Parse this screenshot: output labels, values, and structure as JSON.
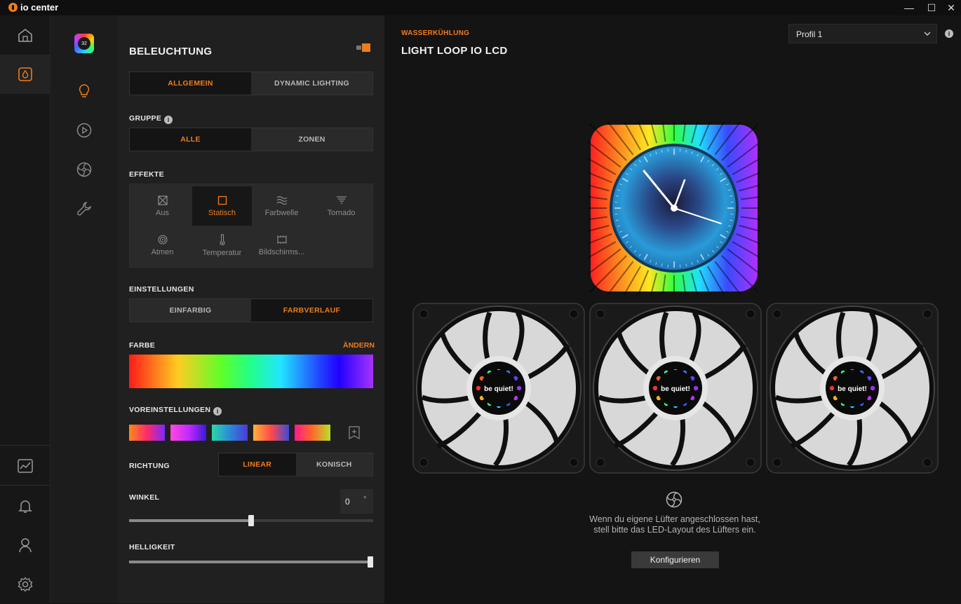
{
  "app": {
    "name": "io center"
  },
  "window_controls": {
    "minimize": "—",
    "maximize": "☐",
    "close": "✕"
  },
  "panel": {
    "title": "BELEUCHTUNG",
    "tabs": [
      "ALLGEMEIN",
      "DYNAMIC LIGHTING"
    ],
    "group_label": "GRUPPE",
    "group_options": [
      "ALLE",
      "ZONEN"
    ],
    "effects_label": "EFFEKTE",
    "effects": [
      "Aus",
      "Statisch",
      "Farbwelle",
      "Tornado",
      "Atmen",
      "Temperatur",
      "Bildschirms..."
    ],
    "selected_effect": "Statisch",
    "settings_label": "EINSTELLUNGEN",
    "settings_options": [
      "EINFARBIG",
      "FARBVERLAUF"
    ],
    "color_label": "FARBE",
    "color_change": "ÄNDERN",
    "presets_label": "VOREINSTELLUNGEN",
    "direction_label": "RICHTUNG",
    "direction_options": [
      "LINEAR",
      "KONISCH"
    ],
    "angle_label": "WINKEL",
    "angle_value": "0",
    "angle_unit": "°",
    "angle_level": 0.5,
    "brightness_label": "HELLIGKEIT",
    "brightness_level": 1.0
  },
  "main": {
    "eyebrow": "WASSERKÜHLUNG",
    "device_title": "LIGHT LOOP IO LCD",
    "profile_selected": "Profil 1",
    "fan_logo": "be quiet!",
    "hint": "Wenn du eigene Lüfter angeschlossen hast, stell bitte das LED-Layout des Lüfters ein.",
    "configure_button": "Konfigurieren"
  },
  "colors": {
    "accent": "#f07c1a",
    "panel_bg": "#202020",
    "main_bg": "#141414"
  },
  "icons": {
    "nav": [
      "home-icon",
      "water-drop-icon",
      "chart-icon",
      "bell-icon",
      "user-icon",
      "gear-icon"
    ],
    "subnav": [
      "lightbulb-icon",
      "play-circle-icon",
      "fan-icon",
      "wrench-icon"
    ]
  }
}
